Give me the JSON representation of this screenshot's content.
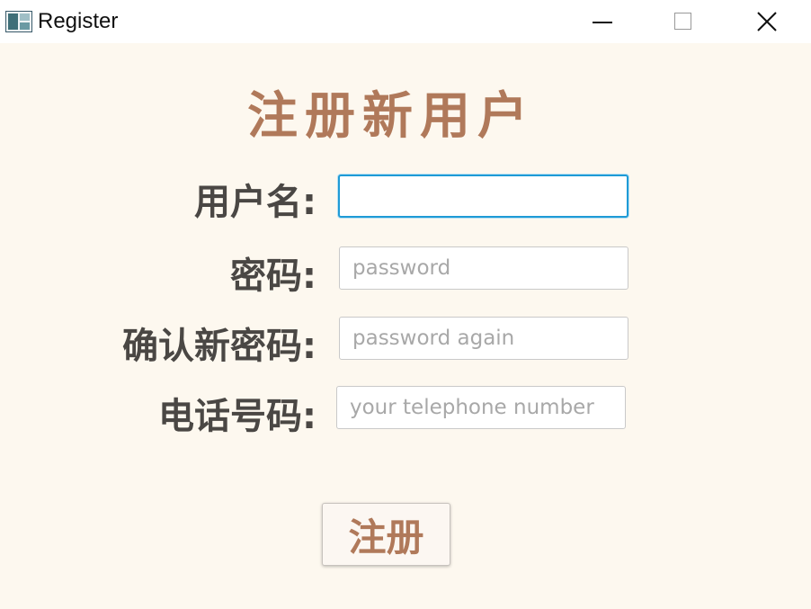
{
  "window": {
    "title": "Register",
    "icon": "app-window-icon",
    "controls": [
      "minimize-icon",
      "maximize-icon",
      "close-icon"
    ]
  },
  "form": {
    "heading": "注册新用户",
    "fields": [
      {
        "label": "用户名:",
        "value": "",
        "placeholder": "",
        "focused": true
      },
      {
        "label": "密码:",
        "value": "",
        "placeholder": "password"
      },
      {
        "label": "确认新密码:",
        "value": "",
        "placeholder": "password again"
      },
      {
        "label": "电话号码:",
        "value": "",
        "placeholder": "your telephone number"
      }
    ],
    "submit_label": "注册"
  },
  "colors": {
    "background": "#fdf8ef",
    "heading": "#b0795a",
    "label": "#4a4744",
    "focus_border": "#1f9bd6"
  }
}
